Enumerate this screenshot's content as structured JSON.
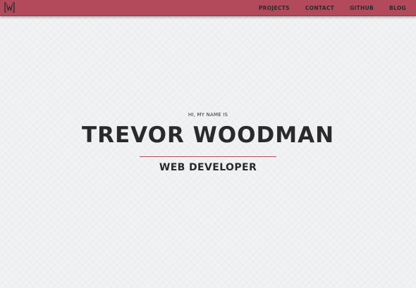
{
  "navbar": {
    "logo_icon": "w-bracket-logo-icon",
    "links": [
      {
        "label": "PROJECTS"
      },
      {
        "label": "CONTACT"
      },
      {
        "label": "GITHUB"
      },
      {
        "label": "BLOG"
      }
    ]
  },
  "hero": {
    "greeting": "HI, MY NAME IS",
    "name": "TREVOR WOODMAN",
    "role": "WEB DEVELOPER"
  },
  "colors": {
    "accent": "#b24a5c",
    "background": "#f1f2f4",
    "text": "#2a2a2a"
  }
}
